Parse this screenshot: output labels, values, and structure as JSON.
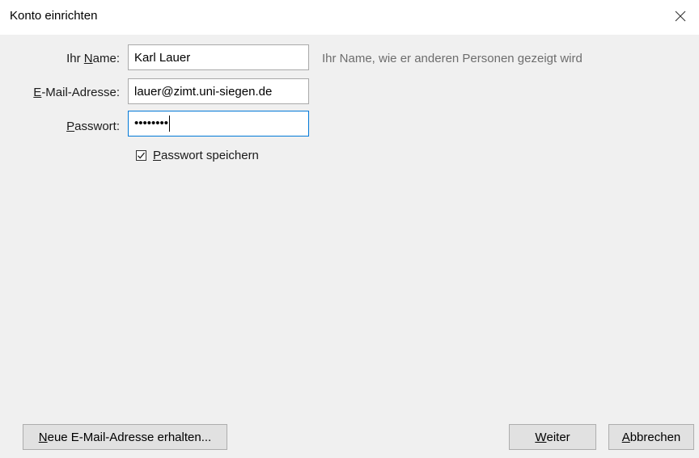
{
  "window": {
    "title": "Konto einrichten",
    "close_icon": "close-icon"
  },
  "form": {
    "name": {
      "label_prefix": "Ihr ",
      "label_accel": "N",
      "label_rest": "ame:",
      "value": "Karl Lauer",
      "hint": "Ihr Name, wie er anderen Personen gezeigt wird"
    },
    "email": {
      "label_accel": "E",
      "label_rest": "-Mail-Adresse:",
      "value": "lauer@zimt.uni-siegen.de"
    },
    "password": {
      "label_accel": "P",
      "label_rest": "asswort:",
      "masked_value": "••••••••"
    },
    "remember_password": {
      "checked": true,
      "label_accel": "P",
      "label_rest": "asswort speichern"
    }
  },
  "buttons": {
    "new_address": {
      "accel": "N",
      "rest": "eue E-Mail-Adresse erhalten..."
    },
    "next": {
      "accel": "W",
      "rest": "eiter"
    },
    "cancel": {
      "accel": "A",
      "rest": "bbrechen"
    }
  },
  "colors": {
    "focus_border": "#0078d7",
    "dialog_bg": "#f0f0f0",
    "hint_text": "#6d6d6d"
  }
}
